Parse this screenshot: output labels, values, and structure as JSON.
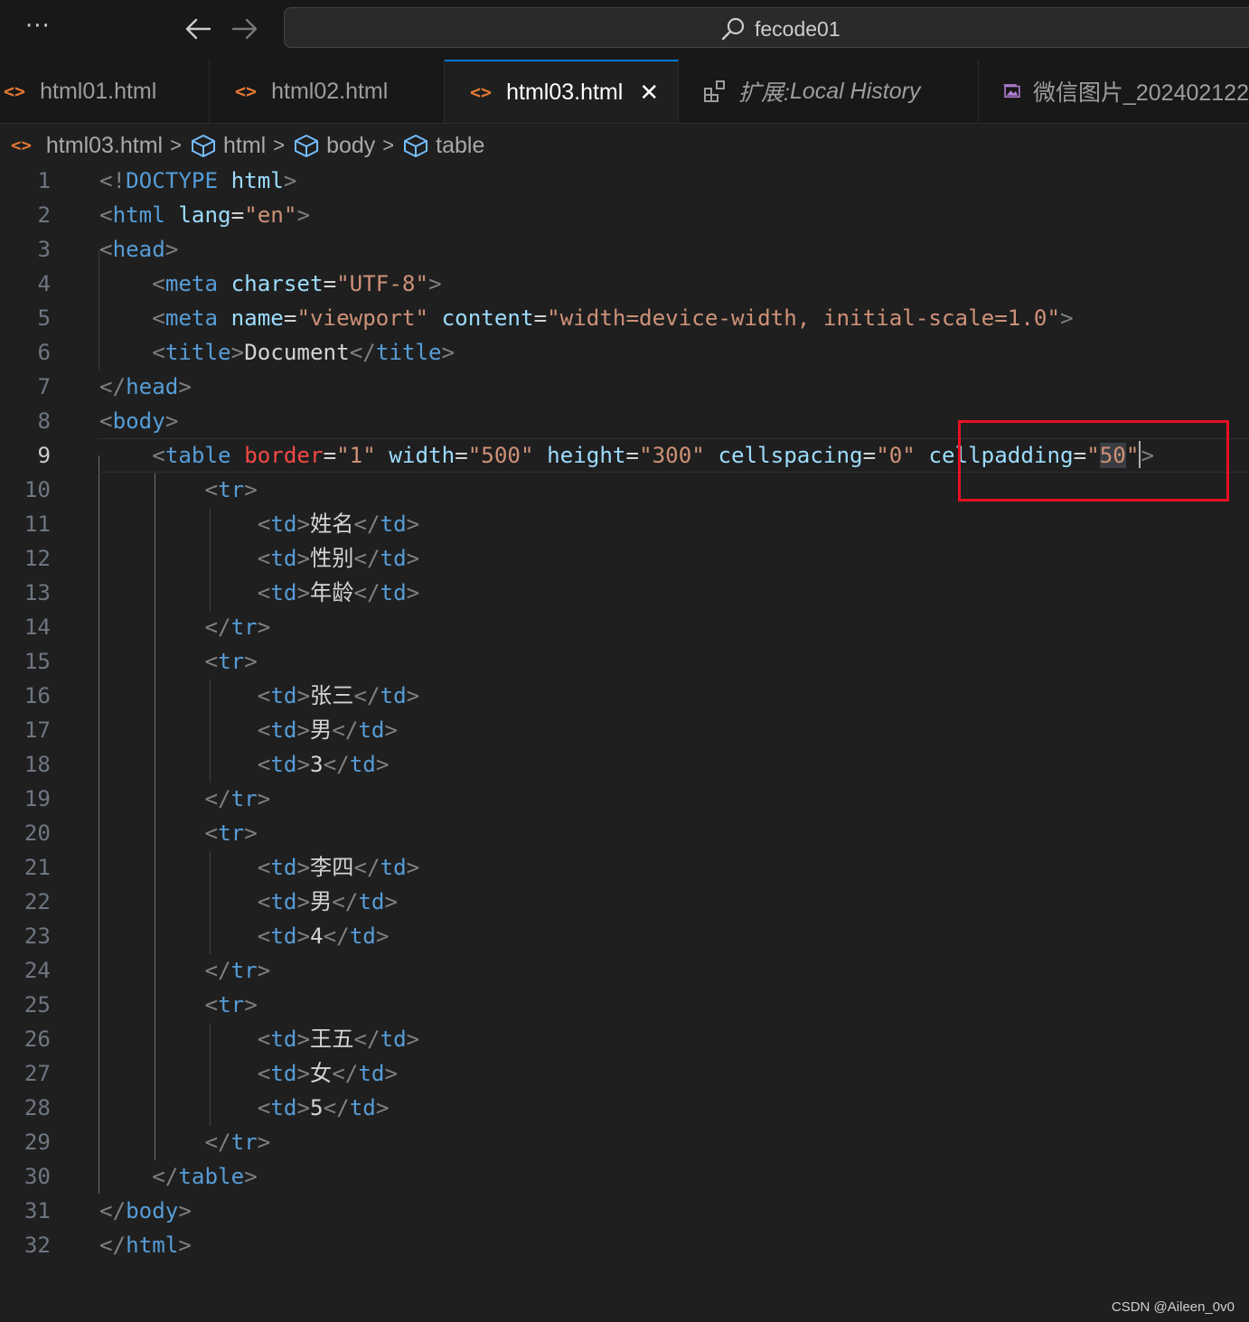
{
  "titlebar": {
    "more_label": "···",
    "search_text": "fecode01"
  },
  "tabs": [
    {
      "label": "html01.html",
      "icon": "html-code-icon",
      "active": false
    },
    {
      "label": "html02.html",
      "icon": "html-code-icon",
      "active": false
    },
    {
      "label": "html03.html",
      "icon": "html-code-icon",
      "active": true,
      "close": "✕"
    },
    {
      "label_prefix": "扩展: ",
      "label": "Local History",
      "icon": "extensions-icon",
      "active": false
    },
    {
      "label": "微信图片_202402122",
      "icon": "image-icon",
      "active": false
    }
  ],
  "breadcrumb": {
    "file": "html03.html",
    "items": [
      "html",
      "body",
      "table"
    ]
  },
  "editor": {
    "current_line": 9,
    "lines": [
      [
        [
          "p",
          "<!"
        ],
        [
          "t",
          "DOCTYPE"
        ],
        [
          "w",
          " "
        ],
        [
          "a",
          "html"
        ],
        [
          "p",
          ">"
        ]
      ],
      [
        [
          "p",
          "<"
        ],
        [
          "t",
          "html"
        ],
        [
          "w",
          " "
        ],
        [
          "a",
          "lang"
        ],
        [
          "w",
          "="
        ],
        [
          "s",
          "\"en\""
        ],
        [
          "p",
          ">"
        ]
      ],
      [
        [
          "p",
          "<"
        ],
        [
          "t",
          "head"
        ],
        [
          "p",
          ">"
        ]
      ],
      [
        [
          "w",
          "    "
        ],
        [
          "p",
          "<"
        ],
        [
          "t",
          "meta"
        ],
        [
          "w",
          " "
        ],
        [
          "a",
          "charset"
        ],
        [
          "w",
          "="
        ],
        [
          "s",
          "\"UTF-8\""
        ],
        [
          "p",
          ">"
        ]
      ],
      [
        [
          "w",
          "    "
        ],
        [
          "p",
          "<"
        ],
        [
          "t",
          "meta"
        ],
        [
          "w",
          " "
        ],
        [
          "a",
          "name"
        ],
        [
          "w",
          "="
        ],
        [
          "s",
          "\"viewport\""
        ],
        [
          "w",
          " "
        ],
        [
          "a",
          "content"
        ],
        [
          "w",
          "="
        ],
        [
          "s",
          "\"width=device-width, initial-scale=1.0\""
        ],
        [
          "p",
          ">"
        ]
      ],
      [
        [
          "w",
          "    "
        ],
        [
          "p",
          "<"
        ],
        [
          "t",
          "title"
        ],
        [
          "p",
          ">"
        ],
        [
          "w",
          "Document"
        ],
        [
          "p",
          "</"
        ],
        [
          "t",
          "title"
        ],
        [
          "p",
          ">"
        ]
      ],
      [
        [
          "p",
          "</"
        ],
        [
          "t",
          "head"
        ],
        [
          "p",
          ">"
        ]
      ],
      [
        [
          "p",
          "<"
        ],
        [
          "t",
          "body"
        ],
        [
          "p",
          ">"
        ]
      ],
      [
        [
          "w",
          "    "
        ],
        [
          "p",
          "<"
        ],
        [
          "t",
          "table"
        ],
        [
          "w",
          " "
        ],
        [
          "ar",
          "border"
        ],
        [
          "w",
          "="
        ],
        [
          "s",
          "\"1\""
        ],
        [
          "w",
          " "
        ],
        [
          "a",
          "width"
        ],
        [
          "w",
          "="
        ],
        [
          "s",
          "\"500\""
        ],
        [
          "w",
          " "
        ],
        [
          "a",
          "height"
        ],
        [
          "w",
          "="
        ],
        [
          "s",
          "\"300\""
        ],
        [
          "w",
          " "
        ],
        [
          "a",
          "cellspacing"
        ],
        [
          "w",
          "="
        ],
        [
          "s",
          "\"0\""
        ],
        [
          "w",
          " "
        ],
        [
          "a",
          "cellpadding"
        ],
        [
          "w",
          "="
        ],
        [
          "s",
          "\""
        ],
        [
          "sel",
          "50"
        ],
        [
          "s",
          "\""
        ],
        [
          "cursor",
          ""
        ],
        [
          "p",
          ">"
        ]
      ],
      [
        [
          "w",
          "        "
        ],
        [
          "p",
          "<"
        ],
        [
          "t",
          "tr"
        ],
        [
          "p",
          ">"
        ]
      ],
      [
        [
          "w",
          "            "
        ],
        [
          "p",
          "<"
        ],
        [
          "t",
          "td"
        ],
        [
          "p",
          ">"
        ],
        [
          "w",
          "姓名"
        ],
        [
          "p",
          "</"
        ],
        [
          "t",
          "td"
        ],
        [
          "p",
          ">"
        ]
      ],
      [
        [
          "w",
          "            "
        ],
        [
          "p",
          "<"
        ],
        [
          "t",
          "td"
        ],
        [
          "p",
          ">"
        ],
        [
          "w",
          "性别"
        ],
        [
          "p",
          "</"
        ],
        [
          "t",
          "td"
        ],
        [
          "p",
          ">"
        ]
      ],
      [
        [
          "w",
          "            "
        ],
        [
          "p",
          "<"
        ],
        [
          "t",
          "td"
        ],
        [
          "p",
          ">"
        ],
        [
          "w",
          "年龄"
        ],
        [
          "p",
          "</"
        ],
        [
          "t",
          "td"
        ],
        [
          "p",
          ">"
        ]
      ],
      [
        [
          "w",
          "        "
        ],
        [
          "p",
          "</"
        ],
        [
          "t",
          "tr"
        ],
        [
          "p",
          ">"
        ]
      ],
      [
        [
          "w",
          "        "
        ],
        [
          "p",
          "<"
        ],
        [
          "t",
          "tr"
        ],
        [
          "p",
          ">"
        ]
      ],
      [
        [
          "w",
          "            "
        ],
        [
          "p",
          "<"
        ],
        [
          "t",
          "td"
        ],
        [
          "p",
          ">"
        ],
        [
          "w",
          "张三"
        ],
        [
          "p",
          "</"
        ],
        [
          "t",
          "td"
        ],
        [
          "p",
          ">"
        ]
      ],
      [
        [
          "w",
          "            "
        ],
        [
          "p",
          "<"
        ],
        [
          "t",
          "td"
        ],
        [
          "p",
          ">"
        ],
        [
          "w",
          "男"
        ],
        [
          "p",
          "</"
        ],
        [
          "t",
          "td"
        ],
        [
          "p",
          ">"
        ]
      ],
      [
        [
          "w",
          "            "
        ],
        [
          "p",
          "<"
        ],
        [
          "t",
          "td"
        ],
        [
          "p",
          ">"
        ],
        [
          "w",
          "3"
        ],
        [
          "p",
          "</"
        ],
        [
          "t",
          "td"
        ],
        [
          "p",
          ">"
        ]
      ],
      [
        [
          "w",
          "        "
        ],
        [
          "p",
          "</"
        ],
        [
          "t",
          "tr"
        ],
        [
          "p",
          ">"
        ]
      ],
      [
        [
          "w",
          "        "
        ],
        [
          "p",
          "<"
        ],
        [
          "t",
          "tr"
        ],
        [
          "p",
          ">"
        ]
      ],
      [
        [
          "w",
          "            "
        ],
        [
          "p",
          "<"
        ],
        [
          "t",
          "td"
        ],
        [
          "p",
          ">"
        ],
        [
          "w",
          "李四"
        ],
        [
          "p",
          "</"
        ],
        [
          "t",
          "td"
        ],
        [
          "p",
          ">"
        ]
      ],
      [
        [
          "w",
          "            "
        ],
        [
          "p",
          "<"
        ],
        [
          "t",
          "td"
        ],
        [
          "p",
          ">"
        ],
        [
          "w",
          "男"
        ],
        [
          "p",
          "</"
        ],
        [
          "t",
          "td"
        ],
        [
          "p",
          ">"
        ]
      ],
      [
        [
          "w",
          "            "
        ],
        [
          "p",
          "<"
        ],
        [
          "t",
          "td"
        ],
        [
          "p",
          ">"
        ],
        [
          "w",
          "4"
        ],
        [
          "p",
          "</"
        ],
        [
          "t",
          "td"
        ],
        [
          "p",
          ">"
        ]
      ],
      [
        [
          "w",
          "        "
        ],
        [
          "p",
          "</"
        ],
        [
          "t",
          "tr"
        ],
        [
          "p",
          ">"
        ]
      ],
      [
        [
          "w",
          "        "
        ],
        [
          "p",
          "<"
        ],
        [
          "t",
          "tr"
        ],
        [
          "p",
          ">"
        ]
      ],
      [
        [
          "w",
          "            "
        ],
        [
          "p",
          "<"
        ],
        [
          "t",
          "td"
        ],
        [
          "p",
          ">"
        ],
        [
          "w",
          "王五"
        ],
        [
          "p",
          "</"
        ],
        [
          "t",
          "td"
        ],
        [
          "p",
          ">"
        ]
      ],
      [
        [
          "w",
          "            "
        ],
        [
          "p",
          "<"
        ],
        [
          "t",
          "td"
        ],
        [
          "p",
          ">"
        ],
        [
          "w",
          "女"
        ],
        [
          "p",
          "</"
        ],
        [
          "t",
          "td"
        ],
        [
          "p",
          ">"
        ]
      ],
      [
        [
          "w",
          "            "
        ],
        [
          "p",
          "<"
        ],
        [
          "t",
          "td"
        ],
        [
          "p",
          ">"
        ],
        [
          "w",
          "5"
        ],
        [
          "p",
          "</"
        ],
        [
          "t",
          "td"
        ],
        [
          "p",
          ">"
        ]
      ],
      [
        [
          "w",
          "        "
        ],
        [
          "p",
          "</"
        ],
        [
          "t",
          "tr"
        ],
        [
          "p",
          ">"
        ]
      ],
      [
        [
          "w",
          "    "
        ],
        [
          "p",
          "</"
        ],
        [
          "t",
          "table"
        ],
        [
          "p",
          ">"
        ]
      ],
      [
        [
          "p",
          "</"
        ],
        [
          "t",
          "body"
        ],
        [
          "p",
          ">"
        ]
      ],
      [
        [
          "p",
          "</"
        ],
        [
          "t",
          "html"
        ],
        [
          "p",
          ">"
        ]
      ]
    ]
  },
  "colors": {
    "background": "#1f1f1f",
    "tag": "#569cd6",
    "attribute": "#9cdcfe",
    "string": "#ce9178",
    "punctuation": "#808080",
    "annotation_box": "#e81123"
  },
  "watermark": "CSDN @Aileen_0v0"
}
